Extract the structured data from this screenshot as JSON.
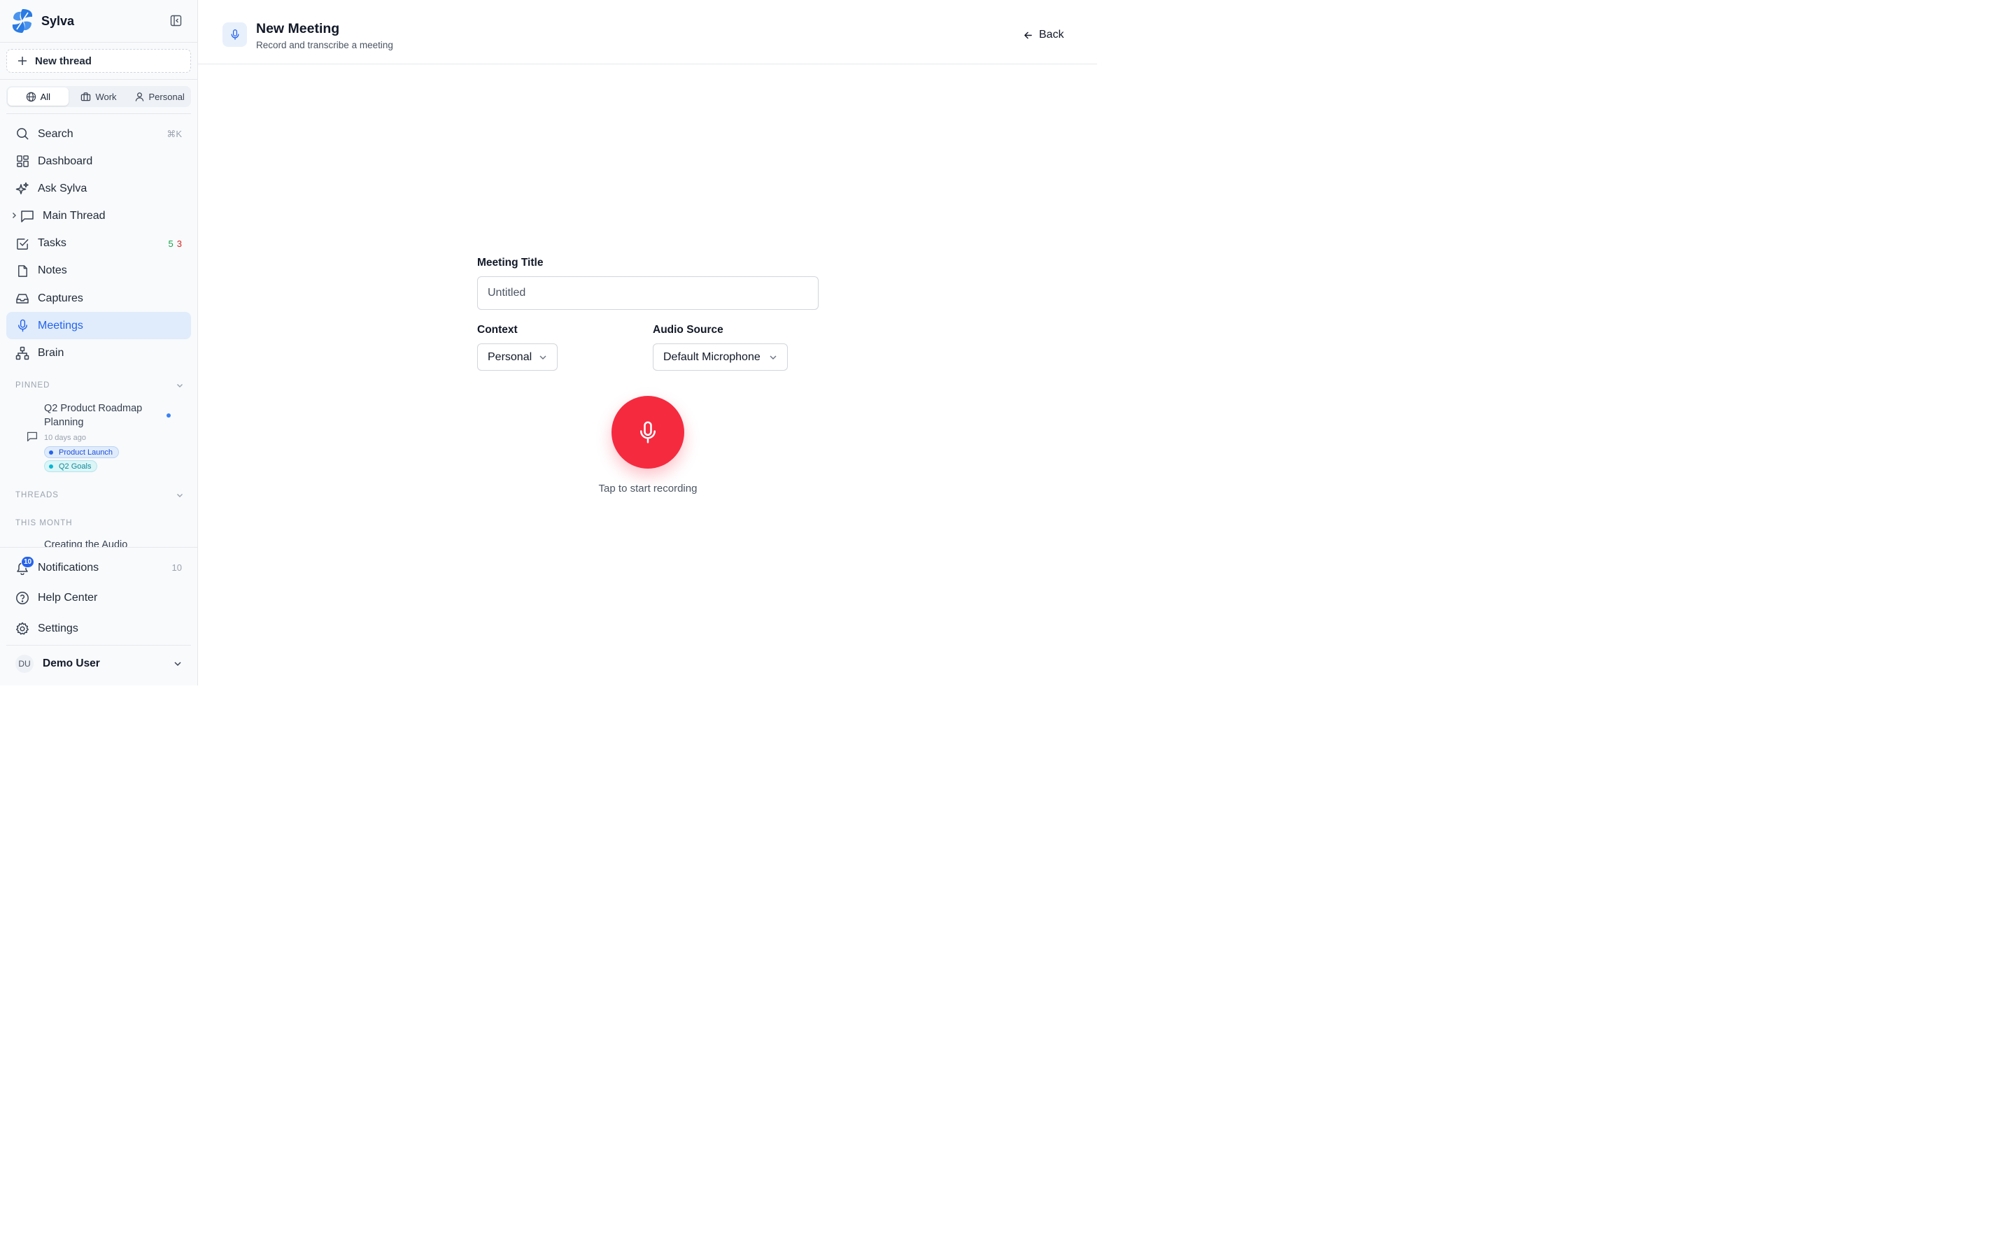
{
  "app": {
    "name": "Sylva"
  },
  "sidebar": {
    "new_thread_label": "New thread",
    "segments": [
      {
        "label": "All",
        "icon": "globe-icon",
        "active": true
      },
      {
        "label": "Work",
        "icon": "briefcase-icon",
        "active": false
      },
      {
        "label": "Personal",
        "icon": "user-icon",
        "active": false
      }
    ],
    "nav": {
      "search": {
        "label": "Search",
        "shortcut": "⌘K"
      },
      "dashboard": {
        "label": "Dashboard"
      },
      "ask": {
        "label": "Ask Sylva"
      },
      "main_thread": {
        "label": "Main Thread"
      },
      "tasks": {
        "label": "Tasks",
        "count_green": "5",
        "count_red": "3"
      },
      "notes": {
        "label": "Notes"
      },
      "captures": {
        "label": "Captures"
      },
      "meetings": {
        "label": "Meetings",
        "active": true
      },
      "brain": {
        "label": "Brain"
      }
    },
    "pinned": {
      "heading": "PINNED",
      "item": {
        "title": "Q2 Product Roadmap Planning",
        "time": "10 days ago",
        "tags": [
          "Product Launch",
          "Q2 Goals"
        ]
      }
    },
    "threads": {
      "heading": "THREADS",
      "group": "THIS MONTH",
      "partial_item": "Creating the Audio"
    },
    "bottom": {
      "notifications": {
        "label": "Notifications",
        "badge": "10",
        "count": "10"
      },
      "help": {
        "label": "Help Center"
      },
      "settings": {
        "label": "Settings"
      }
    },
    "user": {
      "initials": "DU",
      "name": "Demo User"
    }
  },
  "header": {
    "title": "New Meeting",
    "subtitle": "Record and transcribe a meeting",
    "back_label": "Back"
  },
  "form": {
    "title_label": "Meeting Title",
    "title_placeholder": "Untitled",
    "context_label": "Context",
    "context_value": "Personal",
    "audio_label": "Audio Source",
    "audio_value": "Default Microphone",
    "record_hint": "Tap to start recording"
  },
  "colors": {
    "accent": "#2563eb",
    "record": "#f62a3f",
    "active_bg": "#e0ecfb"
  }
}
